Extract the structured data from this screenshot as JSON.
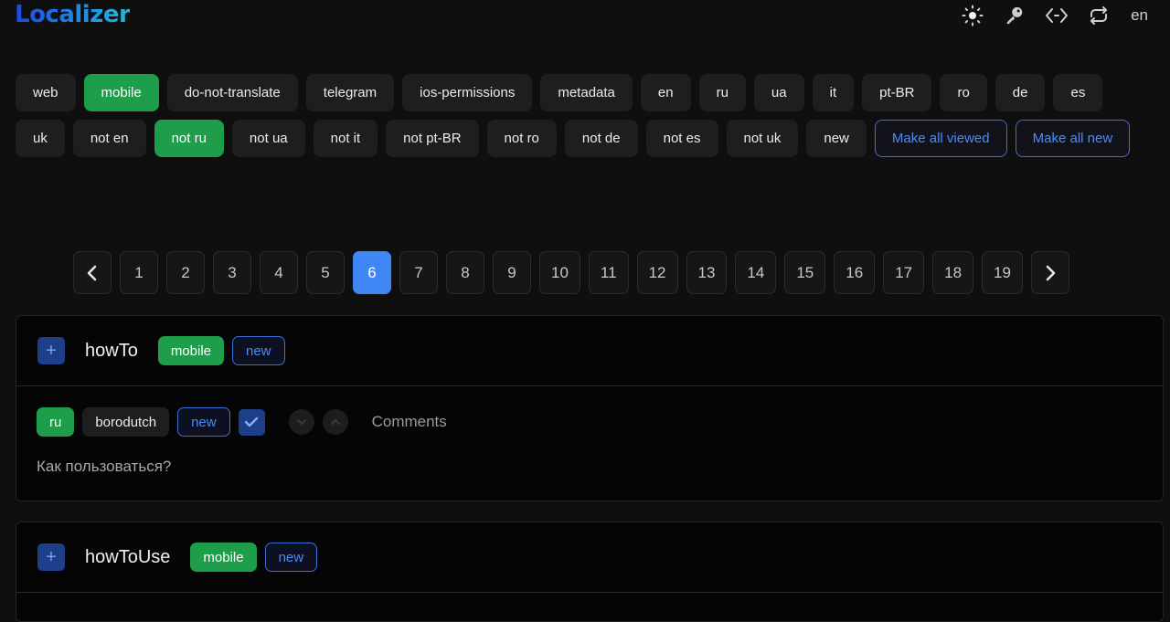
{
  "app": {
    "title": "Localizer",
    "lang": "en"
  },
  "header": {
    "icons": [
      "theme-icon",
      "key-icon",
      "code-icon",
      "sync-icon"
    ]
  },
  "filters": [
    {
      "label": "web",
      "state": "default"
    },
    {
      "label": "mobile",
      "state": "active"
    },
    {
      "label": "do-not-translate",
      "state": "default"
    },
    {
      "label": "telegram",
      "state": "default"
    },
    {
      "label": "ios-permissions",
      "state": "default"
    },
    {
      "label": "metadata",
      "state": "default"
    },
    {
      "label": "en",
      "state": "default"
    },
    {
      "label": "ru",
      "state": "default"
    },
    {
      "label": "ua",
      "state": "default"
    },
    {
      "label": "it",
      "state": "default"
    },
    {
      "label": "pt-BR",
      "state": "default"
    },
    {
      "label": "ro",
      "state": "default"
    },
    {
      "label": "de",
      "state": "default"
    },
    {
      "label": "es",
      "state": "default"
    },
    {
      "label": "uk",
      "state": "default"
    },
    {
      "label": "not en",
      "state": "default"
    },
    {
      "label": "not ru",
      "state": "active"
    },
    {
      "label": "not ua",
      "state": "default"
    },
    {
      "label": "not it",
      "state": "default"
    },
    {
      "label": "not pt-BR",
      "state": "default"
    },
    {
      "label": "not ro",
      "state": "default"
    },
    {
      "label": "not de",
      "state": "default"
    },
    {
      "label": "not es",
      "state": "default"
    },
    {
      "label": "not uk",
      "state": "default"
    },
    {
      "label": "new",
      "state": "default"
    },
    {
      "label": "Make all viewed",
      "state": "outline"
    },
    {
      "label": "Make all new",
      "state": "outline"
    }
  ],
  "pagination": {
    "pages": [
      "1",
      "2",
      "3",
      "4",
      "5",
      "6",
      "7",
      "8",
      "9",
      "10",
      "11",
      "12",
      "13",
      "14",
      "15",
      "16",
      "17",
      "18",
      "19"
    ],
    "current": "6"
  },
  "keys": [
    {
      "name": "howTo",
      "tags": [
        "mobile",
        "new"
      ],
      "translation": {
        "lang": "ru",
        "author": "borodutch",
        "status": "new",
        "comments_label": "Comments",
        "text": "Как пользоваться?"
      }
    },
    {
      "name": "howToUse",
      "tags": [
        "mobile",
        "new"
      ]
    }
  ],
  "colors": {
    "accent": "#3f86f7",
    "green": "#1e9e4a",
    "outline": "#3b6fd8",
    "background": "#0f0f10"
  }
}
